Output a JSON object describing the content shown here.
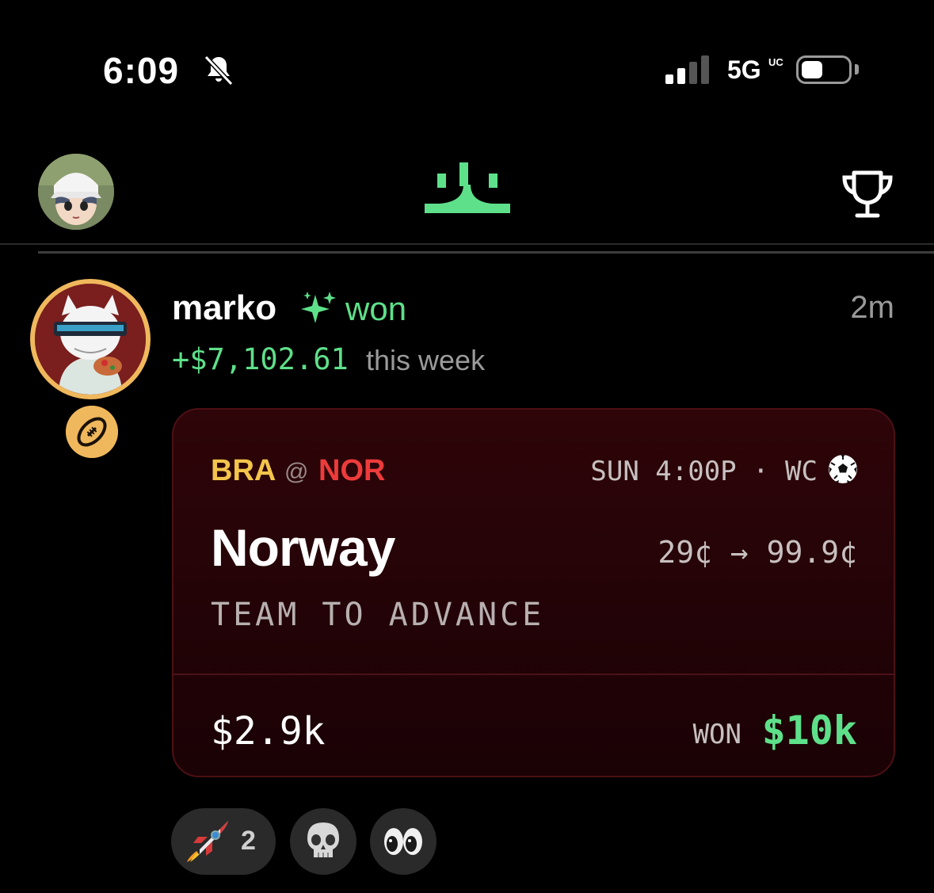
{
  "status_bar": {
    "time": "6:09",
    "network": "5G",
    "network_sub": "UC",
    "icons": [
      "bell-slash-icon",
      "signal-bars-icon",
      "battery-icon"
    ]
  },
  "nav": {
    "avatar": "user-avatar",
    "logo": "app-logo",
    "right_icon": "trophy-icon"
  },
  "post": {
    "username": "marko",
    "badge_icon": "sparkle-icon",
    "action": "won",
    "time_ago": "2m",
    "weekly_gain": "+$7,102.61",
    "weekly_label": "this week",
    "sport_icon": "football-icon"
  },
  "bet_card": {
    "away_team": "BRA",
    "at": "@",
    "home_team": "NOR",
    "schedule": "SUN 4:00P · WC",
    "league_icon": "soccer-ball-icon",
    "pick": "Norway",
    "price": "29¢ → 99.9¢",
    "market": "TEAM TO ADVANCE",
    "stake": "$2.9k",
    "result_label": "WON",
    "payout": "$10k"
  },
  "reactions": [
    {
      "emoji": "rocket-icon",
      "count": "2"
    },
    {
      "emoji": "skull-icon",
      "count": ""
    },
    {
      "emoji": "eyes-icon",
      "count": ""
    }
  ],
  "colors": {
    "accent_green": "#5ee08a",
    "gold": "#f0b85c",
    "away_team": "#f3c54b",
    "home_team": "#ee3b3b",
    "card_bg": "#2e0509"
  }
}
